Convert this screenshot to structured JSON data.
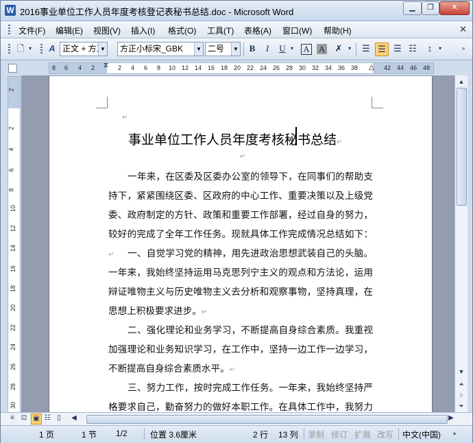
{
  "window": {
    "title": "2016事业单位工作人员年度考核登记表秘书总结.doc - Microsoft Word",
    "app_icon": "W",
    "min_icon": "minimize-icon",
    "max_icon": "maximize-icon",
    "close_icon": "close-icon"
  },
  "menu": {
    "items": [
      "文件(F)",
      "编辑(E)",
      "视图(V)",
      "插入(I)",
      "格式(O)",
      "工具(T)",
      "表格(A)",
      "窗口(W)",
      "帮助(H)"
    ]
  },
  "toolbar": {
    "style_value": "正文 + 方正",
    "font_value": "方正小标宋_GBK",
    "size_value": "二号",
    "bold": "B",
    "italic": "I",
    "underline": "U",
    "char_border": "A",
    "char_shading": "A",
    "active_alignment": "center"
  },
  "ruler": {
    "h_ticks": [
      "8",
      "6",
      "4",
      "2",
      "2",
      "4",
      "6",
      "8",
      "10",
      "12",
      "14",
      "16",
      "18",
      "20",
      "22",
      "24",
      "26",
      "28",
      "30",
      "32",
      "34",
      "36",
      "38",
      "42",
      "44",
      "46",
      "48"
    ],
    "v_ticks": [
      "2",
      "2",
      "4",
      "6",
      "8",
      "10",
      "12",
      "14",
      "16",
      "18",
      "20",
      "22",
      "24",
      "26",
      "28",
      "30"
    ]
  },
  "document": {
    "para_mark": "↵",
    "title": "事业单位工作人员年度考核秘书总结",
    "paragraphs": [
      "一年来，在区委及区委办公室的领导下，在同事们的帮助支持下，紧紧围绕区委、区政府的中心工作、重要决策以及上级党委、政府制定的方针、政策和重要工作部署，经过自身的努力，较好的完成了全年工作任务。现就具体工作完成情况总结如下：",
      "一、自觉学习党的精神，用先进政治思想武装自己的头脑。一年来，我始终坚持运用马克思列宁主义的观点和方法论，运用辩证唯物主义与历史唯物主义去分析和观察事物，坚持真理，在思想上积极要求进步。",
      "二、强化理论和业务学习，不断提高自身综合素质。我重视加强理论和业务知识学习，在工作中，坚持一边工作一边学习，不断提高自身综合素质水平。",
      "三、努力工作，按时完成工作任务。一年来，我始终坚持严格要求自己，勤奋努力的做好本职工作。在具体工作中，我努力做好"
    ]
  },
  "status": {
    "page": "1 页",
    "section": "1 节",
    "pages": "1/2",
    "position": "位置 3.6厘米",
    "line": "2 行",
    "column": "13 列",
    "record": "录制",
    "revise": "修订",
    "extend": "扩展",
    "overtype": "改写",
    "language": "中文(中国)"
  },
  "colors": {
    "accent": "#2b5ea8",
    "active_button": "#ffd27a",
    "doc_background": "#949cb0"
  }
}
